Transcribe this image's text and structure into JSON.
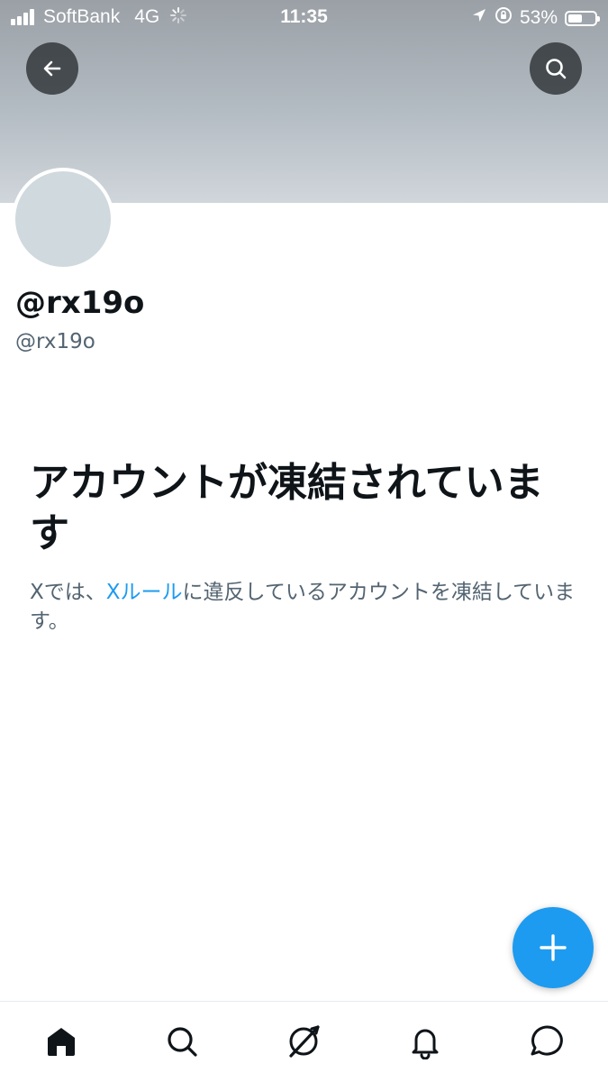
{
  "status_bar": {
    "carrier": "SoftBank",
    "network": "4G",
    "time": "11:35",
    "battery_percent": "53%",
    "battery_level": 0.53
  },
  "header": {
    "back_icon": "arrow-left-icon",
    "search_icon": "search-icon"
  },
  "profile": {
    "display_name": "@rx19o",
    "handle": "@rx19o"
  },
  "suspended": {
    "title": "アカウントが凍結されています",
    "desc_prefix": "Xでは、",
    "rules_link": "Xルール",
    "desc_suffix": "に違反しているアカウントを凍結しています。"
  },
  "fab": {
    "icon": "plus-icon"
  },
  "bottom_nav": {
    "items": [
      "home-icon",
      "search-icon",
      "spaces-icon",
      "bell-icon",
      "message-icon"
    ]
  },
  "colors": {
    "accent": "#1d9bf0",
    "text_primary": "#0f1419",
    "text_secondary": "#536471"
  }
}
